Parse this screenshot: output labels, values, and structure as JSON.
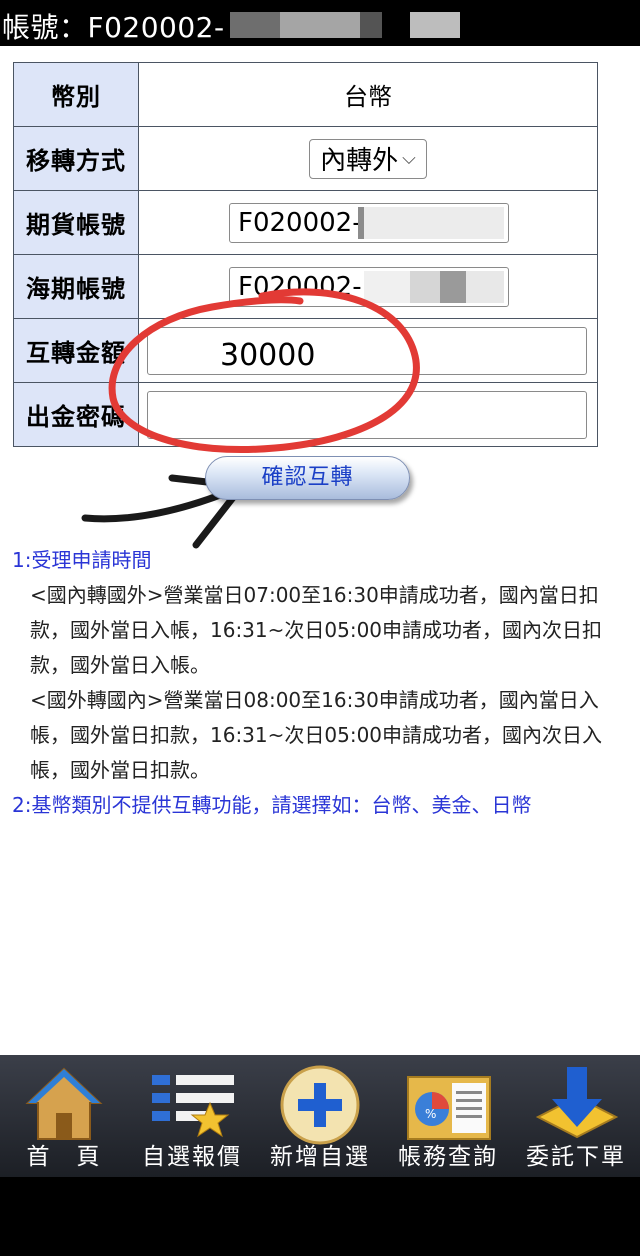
{
  "header": {
    "account_label": "帳號：F020002-"
  },
  "form": {
    "rows": [
      {
        "label": "幣別",
        "value": "台幣"
      },
      {
        "label": "移轉方式",
        "value": "內轉外"
      },
      {
        "label": "期貨帳號",
        "value": "F020002-"
      },
      {
        "label": "海期帳號",
        "value": "F020002-"
      },
      {
        "label": "互轉金額",
        "value": "30000"
      },
      {
        "label": "出金密碼",
        "value": ""
      }
    ]
  },
  "confirm_button": "確認互轉",
  "notes": {
    "item1_title": "1:受理申請時間",
    "item1_line1": "<國內轉國外>營業當日07:00至16:30申請成功者，國內當日扣款，國外當日入帳，16:31~次日05:00申請成功者，國內次日扣款，國外當日入帳。",
    "item1_line2": "<國外轉國內>營業當日08:00至16:30申請成功者，國內當日入帳，國外當日扣款，16:31~次日05:00申請成功者，國內次日入帳，國外當日扣款。",
    "item2": "2:基幣類別不提供互轉功能，請選擇如：台幣、美金、日幣"
  },
  "nav": {
    "home": "首　頁",
    "watchlist": "自選報價",
    "add_watch": "新增自選",
    "account_query": "帳務查詢",
    "place_order": "委託下單"
  },
  "colors": {
    "label_bg": "#dde5f8",
    "accent_blue": "#2a35d6",
    "annotation_red": "#e23a35",
    "navbar": "#2a2d34"
  }
}
